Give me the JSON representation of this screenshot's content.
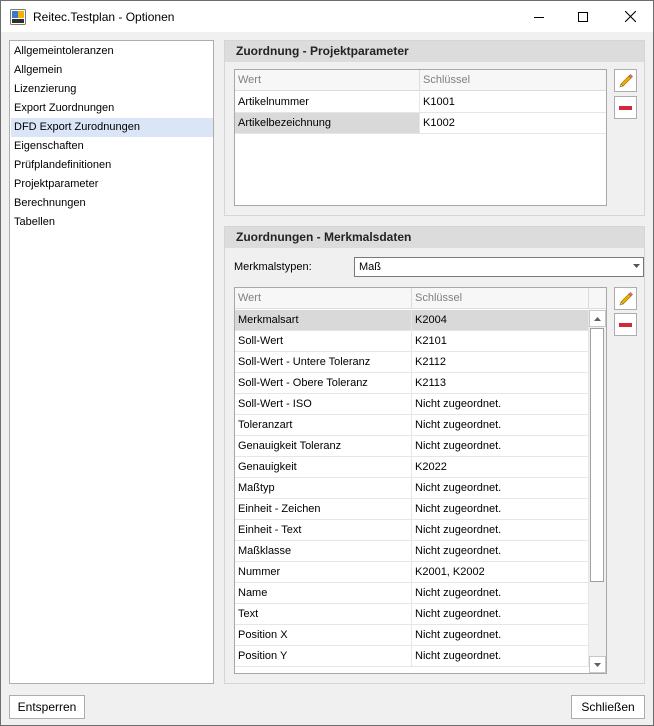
{
  "window": {
    "title": "Reitec.Testplan - Optionen",
    "icon": "app-icon"
  },
  "nav": {
    "items": [
      {
        "label": "Allgemeintoleranzen"
      },
      {
        "label": "Allgemein"
      },
      {
        "label": "Lizenzierung"
      },
      {
        "label": "Export Zuordnungen"
      },
      {
        "label": "DFD Export Zurodnungen",
        "selected": true
      },
      {
        "label": "Eigenschaften"
      },
      {
        "label": "Prüfplandefinitionen"
      },
      {
        "label": "Projektparameter"
      },
      {
        "label": "Berechnungen"
      },
      {
        "label": "Tabellen"
      }
    ]
  },
  "projekt": {
    "header": "Zuordnung - Projektparameter",
    "columns": [
      "Wert",
      "Schlüssel"
    ],
    "rows": [
      {
        "wert": "Artikelnummer",
        "schluessel": "K1001"
      },
      {
        "wert": "Artikelbezeichnung",
        "schluessel": "K1002",
        "selected": true
      }
    ]
  },
  "merkmal": {
    "header": "Zuordnungen - Merkmalsdaten",
    "type_label": "Merkmalstypen:",
    "type_value": "Maß",
    "columns": [
      "Wert",
      "Schlüssel"
    ],
    "rows": [
      {
        "wert": "Merkmalsart",
        "schluessel": "K2004",
        "selected": true
      },
      {
        "wert": "Soll-Wert",
        "schluessel": "K2101"
      },
      {
        "wert": "Soll-Wert - Untere Toleranz",
        "schluessel": "K2112"
      },
      {
        "wert": "Soll-Wert - Obere Toleranz",
        "schluessel": "K2113"
      },
      {
        "wert": "Soll-Wert - ISO",
        "schluessel": "Nicht zugeordnet."
      },
      {
        "wert": "Toleranzart",
        "schluessel": "Nicht zugeordnet."
      },
      {
        "wert": "Genauigkeit Toleranz",
        "schluessel": "Nicht zugeordnet."
      },
      {
        "wert": "Genauigkeit",
        "schluessel": "K2022"
      },
      {
        "wert": "Maßtyp",
        "schluessel": "Nicht zugeordnet."
      },
      {
        "wert": "Einheit - Zeichen",
        "schluessel": "Nicht zugeordnet."
      },
      {
        "wert": "Einheit - Text",
        "schluessel": "Nicht zugeordnet."
      },
      {
        "wert": "Maßklasse",
        "schluessel": "Nicht zugeordnet."
      },
      {
        "wert": "Nummer",
        "schluessel": "K2001, K2002"
      },
      {
        "wert": "Name",
        "schluessel": "Nicht zugeordnet."
      },
      {
        "wert": "Text",
        "schluessel": "Nicht zugeordnet."
      },
      {
        "wert": "Position X",
        "schluessel": "Nicht zugeordnet."
      },
      {
        "wert": "Position Y",
        "schluessel": "Nicht zugeordnet."
      }
    ]
  },
  "footer": {
    "unlock_label": "Entsperren",
    "close_label": "Schließen"
  },
  "colors": {
    "selection": "#dbe5f8",
    "row_selected": "#d9d9d9",
    "remove": "#d2283c",
    "pencil": "#f0b400"
  }
}
